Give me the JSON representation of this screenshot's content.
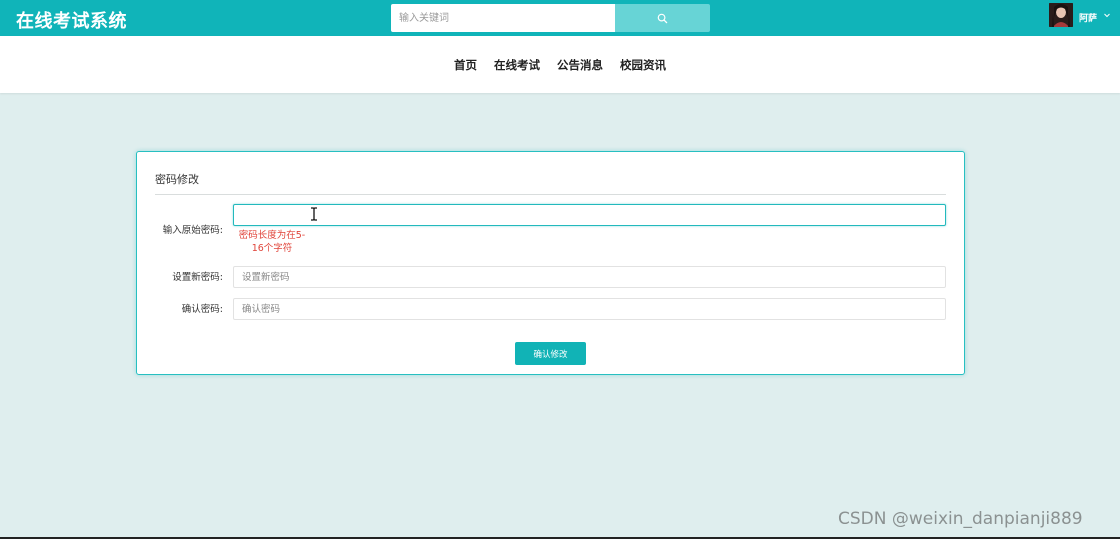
{
  "header": {
    "app_title": "在线考试系统",
    "search_placeholder": "输入关键词",
    "search_icon": "search-icon",
    "user_name": "阿萨",
    "caret_icon": "chevron-down-icon",
    "brand_color": "#10b4b9"
  },
  "nav": {
    "items": [
      "首页",
      "在线考试",
      "公告消息",
      "校园资讯"
    ]
  },
  "card": {
    "title": "密码修改",
    "fields": [
      {
        "label": "输入原始密码:",
        "value": "",
        "placeholder": ""
      },
      {
        "label": "设置新密码:",
        "value": "",
        "placeholder": "设置新密码"
      },
      {
        "label": "确认密码:",
        "value": "",
        "placeholder": "确认密码"
      }
    ],
    "error_message": "密码长度为在5-16个字符",
    "submit_label": "确认修改",
    "error_color": "#e0443a"
  },
  "watermark": "CSDN @weixin_danpianji889"
}
